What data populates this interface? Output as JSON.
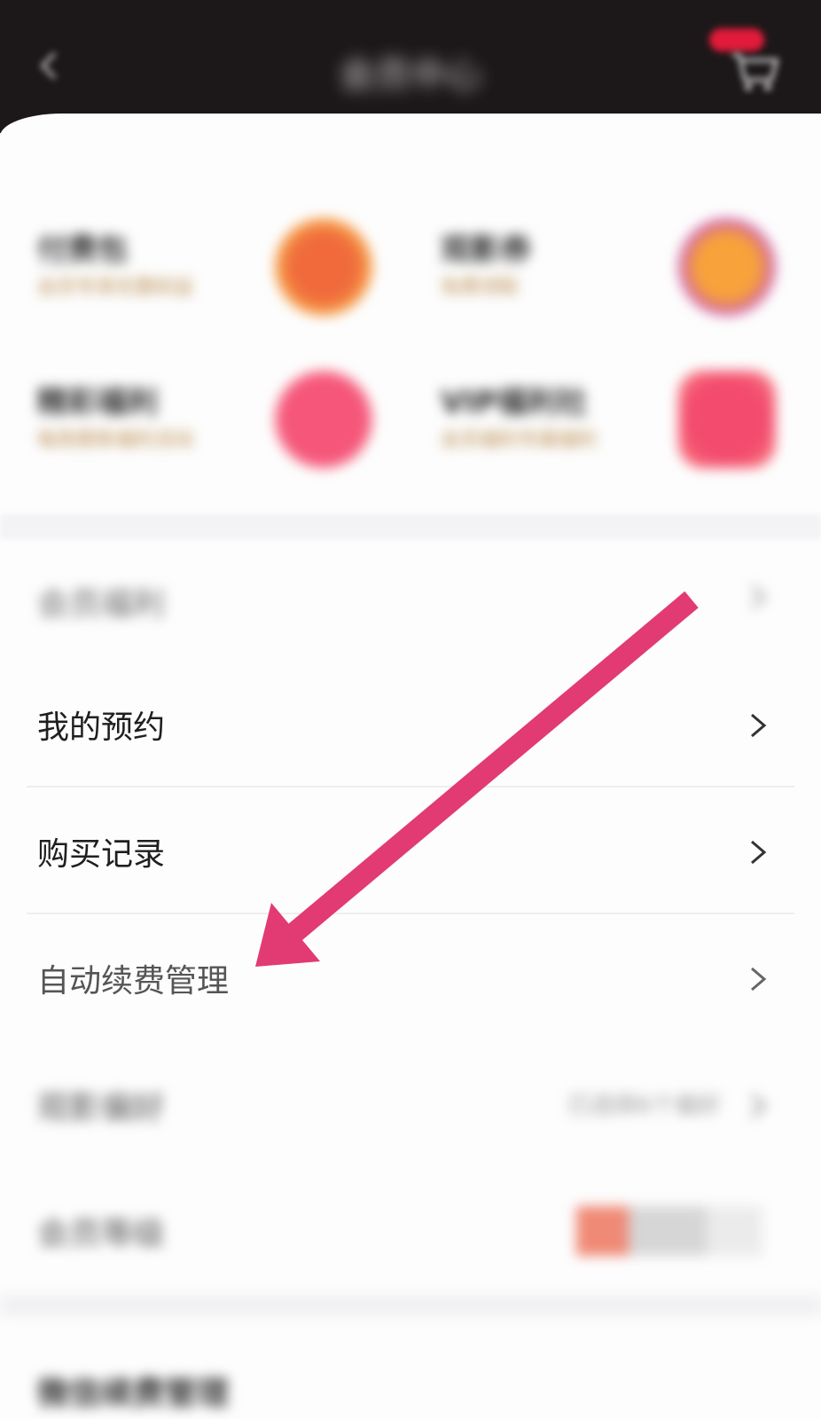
{
  "header": {
    "title": "会员中心"
  },
  "benefits": [
    {
      "title": "付费包",
      "subtitle": "会员专享优惠权益",
      "icon": "coin-icon",
      "color": "#f06a3c"
    },
    {
      "title": "观影券",
      "subtitle": "免费领取",
      "icon": "ticket-icon",
      "color": "#f7a23a"
    },
    {
      "title": "精彩福利",
      "subtitle": "每周更新福利活动",
      "icon": "gift-icon",
      "color": "#f5567a"
    },
    {
      "title": "VIP福利社",
      "subtitle": "会员福利专属福利",
      "icon": "club-icon",
      "color": "#f34b6d"
    }
  ],
  "menu": {
    "item_blur_top": "会员福利",
    "reservation": "我的预约",
    "purchase_history": "购买记录",
    "auto_renew": "自动续费管理",
    "item_blur_1": "观影偏好",
    "item_blur_1_value": "已选择6个偏好",
    "item_blur_2": "会员等级",
    "item_blur_3": "微信续费管理"
  },
  "annotation": {
    "arrow_color": "#e23a72"
  }
}
